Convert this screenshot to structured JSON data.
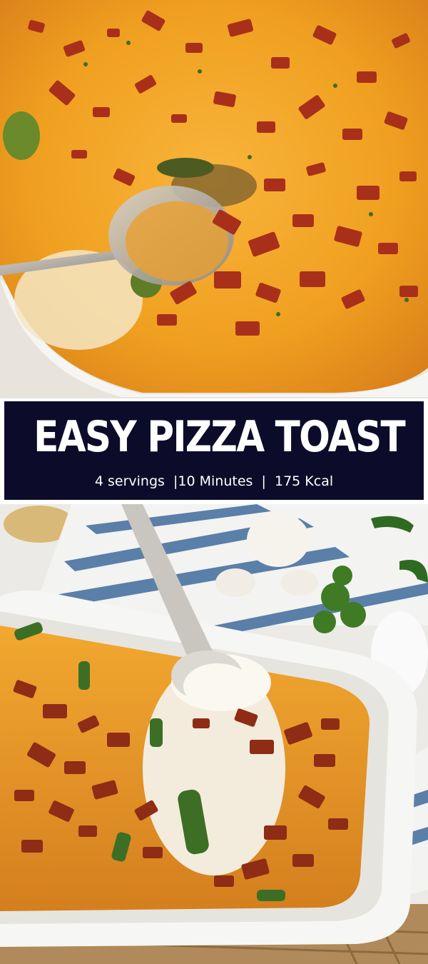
{
  "title": "EASY PIZZA TOAST",
  "subtitle": "4 servings  |10 Minutes  |  175 Kcal",
  "colors": {
    "banner_background": "#0c0c2a",
    "banner_text": "#ffffff",
    "cheese": "#f0a020",
    "bacon": "#b0321a",
    "dish": "#f4f4f2",
    "towel_stripe": "#5a7fa8"
  },
  "images": {
    "top": "cheesy-casserole-with-spoon-photo",
    "bottom": "casserole-in-white-baking-dish-photo"
  }
}
